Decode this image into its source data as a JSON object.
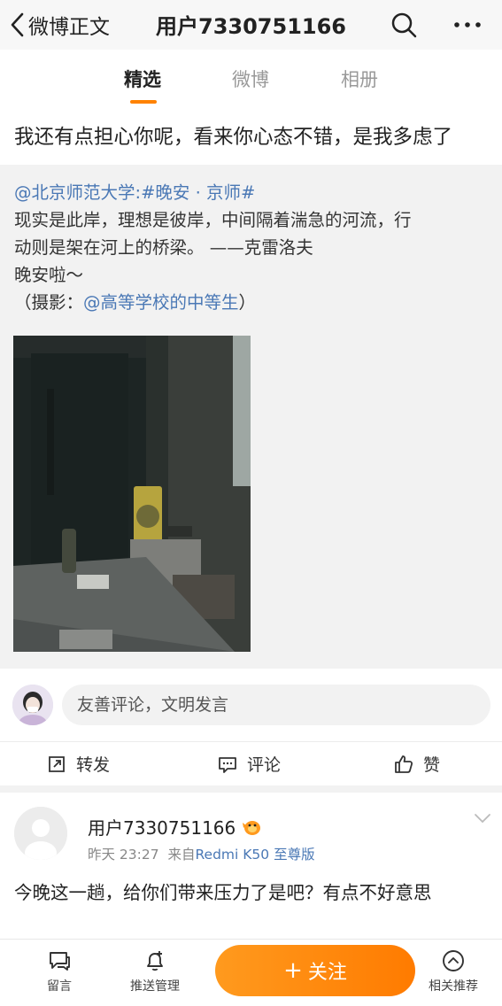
{
  "header": {
    "back_label": "微博正文",
    "title": "用户7330751166"
  },
  "tabs": [
    {
      "label": "精选",
      "active": true
    },
    {
      "label": "微博",
      "active": false
    },
    {
      "label": "相册",
      "active": false
    }
  ],
  "post": {
    "text": "我还有点担心你呢，看来你心态不错，是我多虑了"
  },
  "original_post": {
    "mention": "@北京师范大学",
    "sep": ":",
    "hashtag": "#晚安 · 京师#",
    "line2": "现实是此岸，理想是彼岸，中间隔着湍急的河流，行",
    "line3": "动则是架在河上的桥梁。 ——克雷洛夫",
    "line4": "晚安啦～",
    "credit_prefix": "（摄影：",
    "credit_mention": "@高等学校的中等生",
    "credit_suffix": "）"
  },
  "comment_box": {
    "placeholder": "友善评论，文明发言"
  },
  "actions": {
    "repost": "转发",
    "comment": "评论",
    "like": "赞"
  },
  "comment": {
    "username": "用户7330751166",
    "time": "昨天 23:27",
    "source_prefix": "来自",
    "device": "Redmi K50 至尊版",
    "text": "今晚这一趟，给你们带来压力了是吧？有点不好意思"
  },
  "bottom_bar": {
    "message": "留言",
    "push": "推送管理",
    "follow": "关注",
    "related": "相关推荐"
  },
  "colors": {
    "accent": "#ff8200",
    "link": "#4a78b5"
  }
}
